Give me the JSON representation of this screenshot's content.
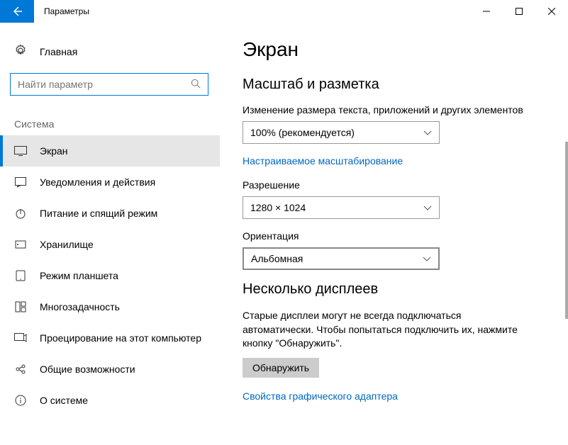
{
  "window": {
    "title": "Параметры"
  },
  "sidebar": {
    "home": "Главная",
    "search_placeholder": "Найти параметр",
    "group": "Система",
    "items": [
      {
        "label": "Экран"
      },
      {
        "label": "Уведомления и действия"
      },
      {
        "label": "Питание и спящий режим"
      },
      {
        "label": "Хранилище"
      },
      {
        "label": "Режим планшета"
      },
      {
        "label": "Многозадачность"
      },
      {
        "label": "Проецирование на этот компьютер"
      },
      {
        "label": "Общие возможности"
      },
      {
        "label": "О системе"
      }
    ]
  },
  "main": {
    "title": "Экран",
    "section_scale": "Масштаб и разметка",
    "scale_label": "Изменение размера текста, приложений и других элементов",
    "scale_value": "100% (рекомендуется)",
    "advanced_scaling": "Настраиваемое масштабирование",
    "resolution_label": "Разрешение",
    "resolution_value": "1280 × 1024",
    "orientation_label": "Ориентация",
    "orientation_value": "Альбомная",
    "section_multi": "Несколько дисплеев",
    "multi_text": "Старые дисплеи могут не всегда подключаться автоматически. Чтобы попытаться подключить их, нажмите кнопку \"Обнаружить\".",
    "detect_btn": "Обнаружить",
    "gpu_props": "Свойства графического адаптера"
  }
}
